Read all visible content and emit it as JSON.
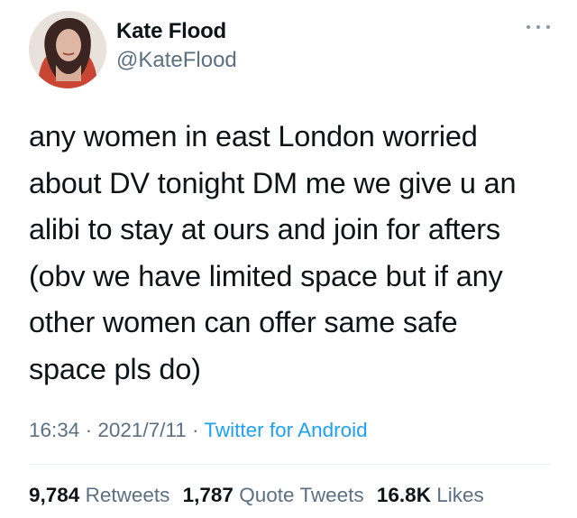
{
  "author": {
    "name": "Kate Flood",
    "handle": "@KateFlood"
  },
  "tweet": {
    "lines": [
      "any women in east London worried",
      "about DV tonight DM me we give u an",
      "alibi to stay at ours and join for afters",
      "(obv we have limited space but if any",
      "other women can offer same safe",
      "space pls do)"
    ],
    "time": "16:34",
    "date": "2021/7/11",
    "separator": " · ",
    "source": "Twitter for Android"
  },
  "stats": {
    "retweets_count": "9,784",
    "retweets_label": "Retweets",
    "quotes_count": "1,787",
    "quotes_label": "Quote Tweets",
    "likes_count": "16.8K",
    "likes_label": "Likes"
  },
  "icons": {
    "more": "more-horizontal-icon"
  },
  "colors": {
    "text": "#0f1419",
    "secondary": "#5b7083",
    "link": "#1da1f2",
    "divider": "#e6ecf0"
  }
}
